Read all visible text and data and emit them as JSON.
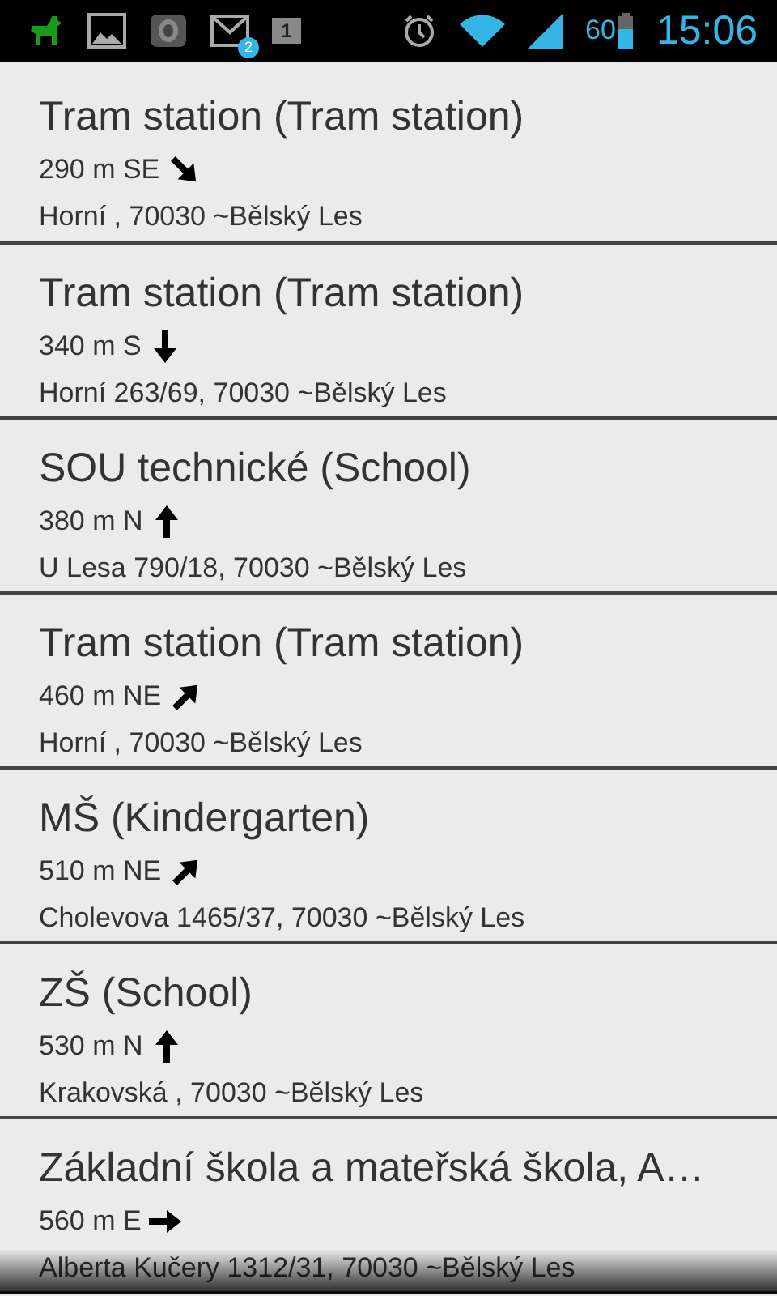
{
  "status_bar": {
    "mail_count": "2",
    "calendar_day": "1",
    "battery_percent": "60",
    "time": "15:06"
  },
  "places": [
    {
      "name": "Tram station (Tram station)",
      "distance": "290 m SE",
      "kind": "se",
      "address": "Horní , 70030 ~Bělský Les"
    },
    {
      "name": "Tram station (Tram station)",
      "distance": "340 m S",
      "kind": "s",
      "address": "Horní 263/69, 70030 ~Bělský Les"
    },
    {
      "name": "SOU technické (School)",
      "distance": "380 m N",
      "kind": "n",
      "address": "U Lesa 790/18, 70030 ~Bělský Les"
    },
    {
      "name": "Tram station (Tram station)",
      "distance": "460 m NE",
      "kind": "ne",
      "address": "Horní , 70030 ~Bělský Les"
    },
    {
      "name": "MŠ (Kindergarten)",
      "distance": "510 m NE",
      "kind": "ne",
      "address": "Cholevova 1465/37, 70030 ~Bělský Les"
    },
    {
      "name": "ZŠ (School)",
      "distance": "530 m N",
      "kind": "n",
      "address": "Krakovská , 70030 ~Bělský Les"
    },
    {
      "name": "Základní škola a mateřská škola, A…",
      "distance": "560 m E",
      "kind": "e",
      "address": "Alberta Kučery 1312/31, 70030 ~Bělský Les"
    }
  ]
}
